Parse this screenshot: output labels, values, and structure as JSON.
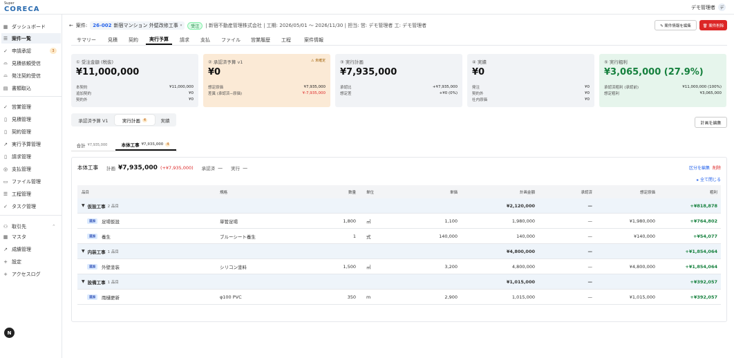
{
  "header": {
    "logo_super": "Super",
    "logo_main": "CORECA",
    "user_name": "デモ管理者",
    "user_avatar": "デ"
  },
  "sidebar": {
    "items": [
      {
        "label": "ダッシュボード",
        "icon": "grid-icon",
        "glyph": "▦"
      },
      {
        "label": "案件一覧",
        "icon": "list-icon",
        "glyph": "☰"
      },
      {
        "label": "申請承認",
        "icon": "check-icon",
        "glyph": "✓",
        "badge": "3"
      },
      {
        "label": "見積依頼受信",
        "icon": "inbox-icon",
        "glyph": "⌓"
      },
      {
        "label": "発注契約受信",
        "icon": "inbox-icon",
        "glyph": "⌓"
      },
      {
        "label": "書類取込",
        "icon": "document-icon",
        "glyph": "▤"
      },
      {
        "label": "営業管理",
        "icon": "check-icon",
        "glyph": "✓"
      },
      {
        "label": "見積管理",
        "icon": "file-icon",
        "glyph": "▯"
      },
      {
        "label": "契約管理",
        "icon": "file-icon",
        "glyph": "▯"
      },
      {
        "label": "実行予算管理",
        "icon": "trend-icon",
        "glyph": "↗"
      },
      {
        "label": "請求管理",
        "icon": "file-icon",
        "glyph": "▯"
      },
      {
        "label": "支払管理",
        "icon": "circle-icon",
        "glyph": "◎"
      },
      {
        "label": "ファイル管理",
        "icon": "folder-icon",
        "glyph": "▭"
      },
      {
        "label": "工程管理",
        "icon": "list-icon",
        "glyph": "☰"
      },
      {
        "label": "タスク管理",
        "icon": "check-icon",
        "glyph": "✓"
      },
      {
        "label": "取引先",
        "icon": "people-icon",
        "glyph": "⚇",
        "chevron": "^"
      },
      {
        "label": "マスタ",
        "icon": "table-icon",
        "glyph": "▦"
      },
      {
        "label": "成績管理",
        "icon": "trend-icon",
        "glyph": "↗"
      },
      {
        "label": "設定",
        "icon": "plus-icon",
        "glyph": "+"
      },
      {
        "label": "アクセスログ",
        "icon": "plus-icon",
        "glyph": "+"
      }
    ],
    "bottom_button": "N"
  },
  "project": {
    "back": "←",
    "case_label": "案件:",
    "code": "26-002",
    "name": "新宿マンション 外壁改修工事",
    "status": "受注",
    "meta": "| 新宿不動産管理株式会社 | 工期: 2026/05/01 ～ 2026/11/30 | 担当: 営: デモ管理者 工: デモ管理者",
    "edit_button": "✎ 案件情報を編集",
    "delete_button": "🗑 案件削除"
  },
  "tabs": [
    "サマリー",
    "見積",
    "契約",
    "実行予算",
    "請求",
    "支払",
    "ファイル",
    "営業履歴",
    "工程",
    "案件情報"
  ],
  "cards": [
    {
      "title": "① 受注金額 (税抜)",
      "value": "¥11,000,000",
      "bg": "#f1f3f6",
      "rows": [
        [
          "本契約",
          "¥11,000,000"
        ],
        [
          "追加契約",
          "¥0"
        ],
        [
          "契約外",
          "¥0"
        ]
      ]
    },
    {
      "title": "② 承認済予算 v1",
      "warn": "⚠ 未確定",
      "value": "¥0",
      "bg": "#fbead6",
      "rows": [
        [
          "想定原価",
          "¥7,935,000"
        ],
        [
          "差異 (承認済−原価)",
          "¥-7,935,000"
        ]
      ]
    },
    {
      "title": "③ 実行計画",
      "value": "¥7,935,000",
      "bg": "#f1f3f6",
      "rows": [
        [
          "承認比",
          "+¥7,935,000"
        ],
        [
          "想定差",
          "+¥0 (0%)"
        ]
      ]
    },
    {
      "title": "④ 実績",
      "value": "¥0",
      "bg": "#f1f3f6",
      "rows": [
        [
          "発注",
          "¥0"
        ],
        [
          "契約外",
          "¥0"
        ],
        [
          "社内原価",
          "¥0"
        ]
      ]
    },
    {
      "title": "⑤ 実行粗利",
      "value": "¥3,065,000 (27.9%)",
      "bg": "#e6f5ec",
      "green": true,
      "rows": [
        [
          "承認済粗利 (承認前)",
          "¥11,000,000 (100%)"
        ],
        [
          "想定粗利",
          "¥3,065,000"
        ]
      ]
    }
  ],
  "subtabs": [
    {
      "label": "承認済予算 V1"
    },
    {
      "label": "実行計画",
      "badge": "4"
    },
    {
      "label": "実績"
    }
  ],
  "plan_edit_button": "計画を編集",
  "sections": [
    {
      "label": "合計",
      "amount": "¥7,935,000"
    },
    {
      "label": "本体工事",
      "amount": "¥7,935,000",
      "badge": "4"
    }
  ],
  "panel": {
    "title": "本体工事",
    "plan_label": "計画",
    "plan_value": "¥7,935,000",
    "plan_diff": "(+¥7,935,000)",
    "approved_label": "承認済",
    "approved_value": "—",
    "actual_label": "実行",
    "actual_value": "—",
    "edit_section": "区分を編集",
    "delete_section": "削除",
    "close_all": "▸ 全て閉じる"
  },
  "table": {
    "headers": [
      "品目",
      "規格",
      "数量",
      "単位",
      "単価",
      "計画金額",
      "承認済",
      "想定原価",
      "粗利"
    ],
    "groups": [
      {
        "name": "仮設工事",
        "count": "2 品目",
        "amount": "¥2,120,000",
        "approved": "—",
        "profit": "+¥818,878",
        "items": [
          {
            "tag": "追加",
            "name": "足場仮設",
            "spec": "単管足場",
            "qty": "1,800",
            "unit": "㎡",
            "price": "1,100",
            "amount": "1,980,000",
            "approved": "—",
            "cost": "¥1,980,000",
            "profit": "+¥764,802"
          },
          {
            "tag": "追加",
            "name": "養生",
            "spec": "ブルーシート養生",
            "qty": "1",
            "unit": "式",
            "price": "140,000",
            "amount": "140,000",
            "approved": "—",
            "cost": "¥140,000",
            "profit": "+¥54,077"
          }
        ]
      },
      {
        "name": "内装工事",
        "count": "1 品目",
        "amount": "¥4,800,000",
        "approved": "—",
        "profit": "+¥1,854,064",
        "items": [
          {
            "tag": "追加",
            "name": "外壁塗装",
            "spec": "シリコン塗料",
            "qty": "1,500",
            "unit": "㎡",
            "price": "3,200",
            "amount": "4,800,000",
            "approved": "—",
            "cost": "¥4,800,000",
            "profit": "+¥1,854,064"
          }
        ]
      },
      {
        "name": "設備工事",
        "count": "1 品目",
        "amount": "¥1,015,000",
        "approved": "—",
        "profit": "+¥392,057",
        "items": [
          {
            "tag": "追加",
            "name": "雨樋更新",
            "spec": "φ100 PVC",
            "qty": "350",
            "unit": "m",
            "price": "2,900",
            "amount": "1,015,000",
            "approved": "—",
            "cost": "¥1,015,000",
            "profit": "+¥392,057"
          }
        ]
      }
    ]
  }
}
